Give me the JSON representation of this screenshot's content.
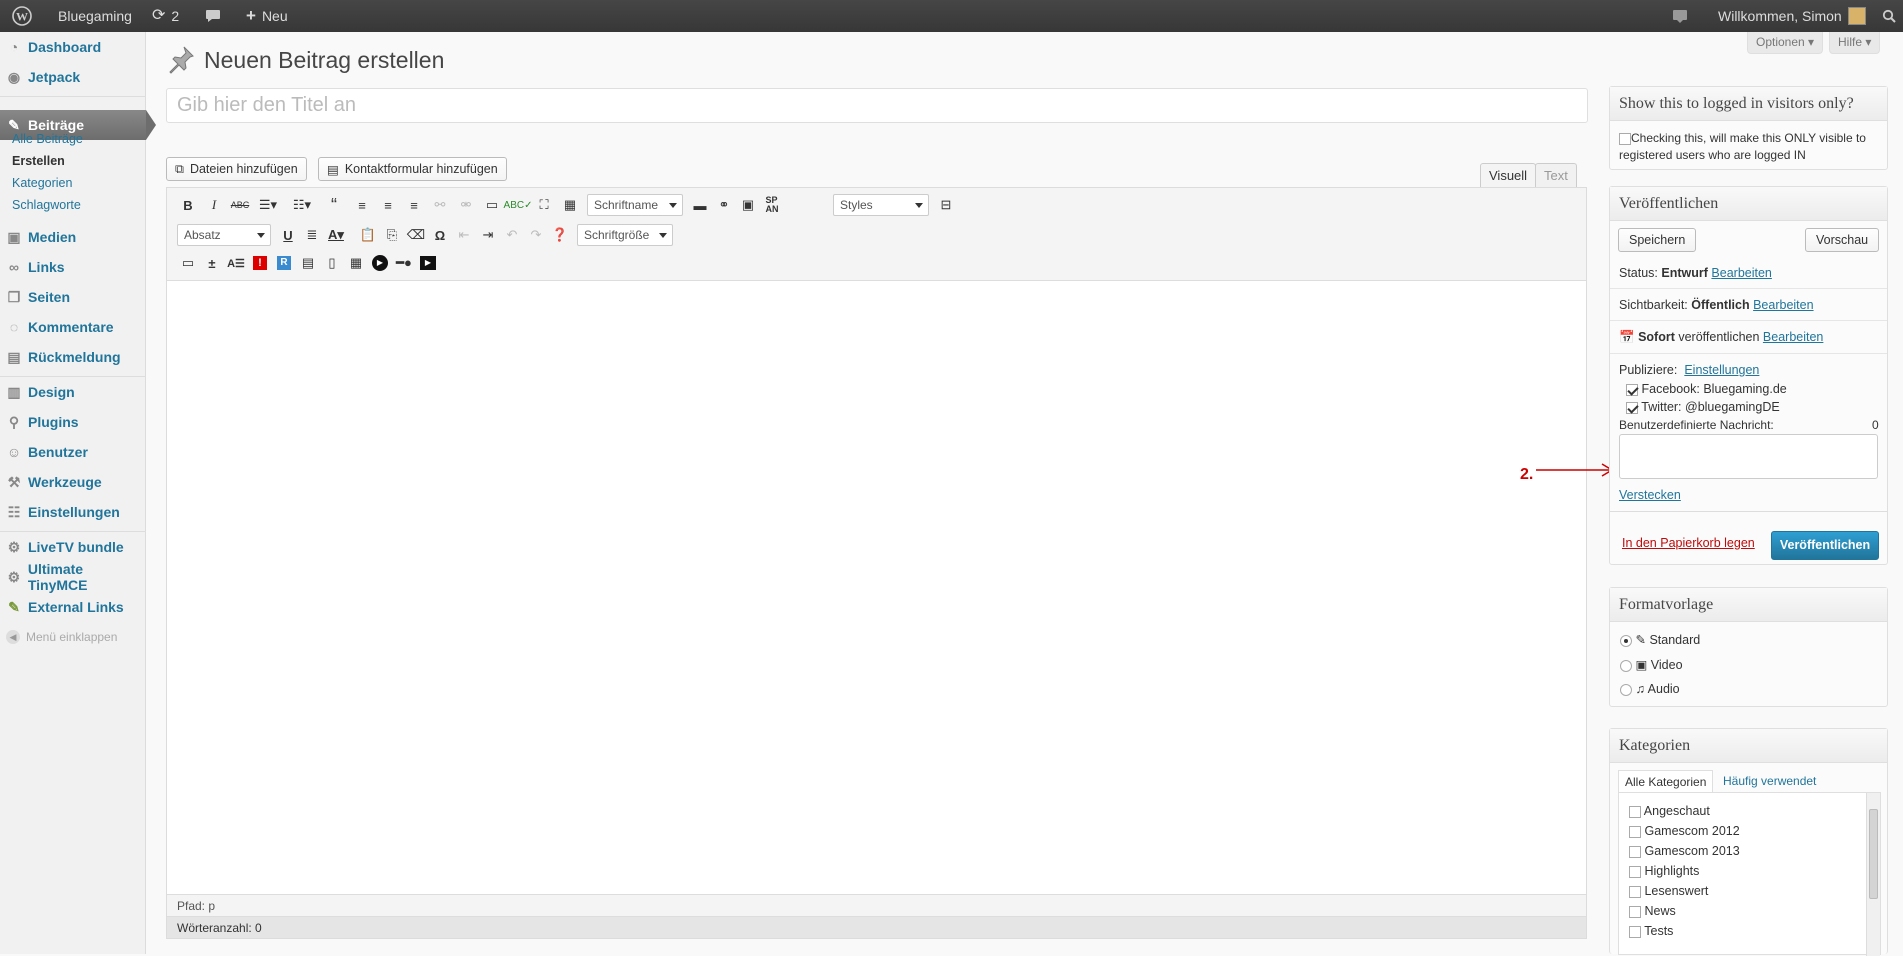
{
  "adminbar": {
    "site_name": "Bluegaming",
    "updates_count": "2",
    "new_label": "Neu",
    "welcome": "Willkommen, Simon"
  },
  "sidebar": {
    "items": [
      {
        "label": "Dashboard",
        "icon": "dashboard-icon"
      },
      {
        "label": "Jetpack",
        "icon": "jetpack-icon"
      },
      {
        "label": "Beiträge",
        "icon": "pin-icon"
      },
      {
        "label": "Medien",
        "icon": "media-icon"
      },
      {
        "label": "Links",
        "icon": "links-icon"
      },
      {
        "label": "Seiten",
        "icon": "pages-icon"
      },
      {
        "label": "Kommentare",
        "icon": "comments-icon"
      },
      {
        "label": "Rückmeldung",
        "icon": "feedback-icon"
      },
      {
        "label": "Design",
        "icon": "design-icon"
      },
      {
        "label": "Plugins",
        "icon": "plugins-icon"
      },
      {
        "label": "Benutzer",
        "icon": "users-icon"
      },
      {
        "label": "Werkzeuge",
        "icon": "tools-icon"
      },
      {
        "label": "Einstellungen",
        "icon": "settings-icon"
      },
      {
        "label": "LiveTV bundle",
        "icon": "gear-icon"
      },
      {
        "label": "Ultimate TinyMCE",
        "icon": "gear-icon"
      },
      {
        "label": "External Links",
        "icon": "external-links-icon"
      }
    ],
    "submenu": [
      "Alle Beiträge",
      "Erstellen",
      "Kategorien",
      "Schlagworte"
    ],
    "collapse_label": "Menü einklappen"
  },
  "screen": {
    "options_label": "Optionen",
    "help_label": "Hilfe"
  },
  "page": {
    "heading": "Neuen Beitrag erstellen",
    "title_placeholder": "Gib hier den Titel an"
  },
  "media": {
    "add_files": "Dateien hinzufügen",
    "add_contact_form": "Kontaktformular hinzufügen"
  },
  "editor": {
    "tab_visual": "Visuell",
    "tab_text": "Text",
    "font_name": "Schriftname",
    "styles": "Styles",
    "paragraph": "Absatz",
    "font_size": "Schriftgröße",
    "path": "Pfad: p",
    "word_count": "Wörteranzahl: 0"
  },
  "visibility_box": {
    "title": "Show this to logged in visitors only?",
    "checkbox_text_line1": "Checking this, will make this ONLY visible to",
    "checkbox_text_line2": "registered users who are logged IN"
  },
  "publish_box": {
    "title": "Veröffentlichen",
    "save_label": "Speichern",
    "preview_label": "Vorschau",
    "status_label": "Status:",
    "status_value": "Entwurf",
    "visibility_label": "Sichtbarkeit:",
    "visibility_value": "Öffentlich",
    "schedule_value": "Sofort",
    "schedule_suffix": "veröffentlichen",
    "edit_label": "Bearbeiten",
    "publicize_label": "Publiziere:",
    "publicize_settings": "Einstellungen",
    "facebook": "Facebook: Bluegaming.de",
    "twitter": "Twitter: @bluegamingDE",
    "custom_message_label": "Benutzerdefinierte Nachricht:",
    "custom_message_count": "0",
    "hide_label": "Verstecken",
    "trash_label": "In den Papierkorb legen",
    "publish_label": "Veröffentlichen"
  },
  "annotation": {
    "label": "2.",
    "color": "#cc0000"
  },
  "format_box": {
    "title": "Formatvorlage",
    "options": [
      "Standard",
      "Video",
      "Audio"
    ]
  },
  "categories_box": {
    "title": "Kategorien",
    "tab_all": "Alle Kategorien",
    "tab_frequent": "Häufig verwendet",
    "items": [
      "Angeschaut",
      "Gamescom 2012",
      "Gamescom 2013",
      "Highlights",
      "Lesenswert",
      "News",
      "Tests"
    ]
  },
  "colors": {
    "link": "#21759b",
    "publish_button": "#2e8ac1",
    "trash": "#bc0b0b"
  }
}
